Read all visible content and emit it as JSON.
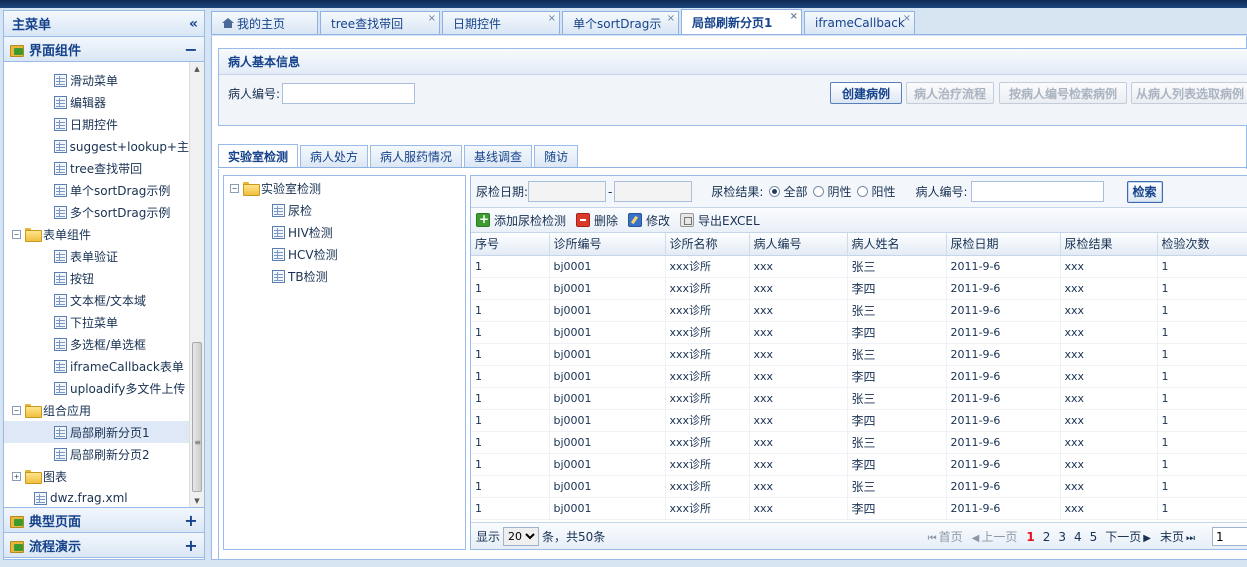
{
  "sidebar": {
    "title": "主菜单",
    "collapse_glyph": "«",
    "sections": [
      {
        "label": "界面组件",
        "toggle": "−"
      },
      {
        "label": "典型页面",
        "toggle": "+"
      },
      {
        "label": "流程演示",
        "toggle": "+"
      }
    ],
    "tree": [
      {
        "label": "滑动菜单",
        "type": "page",
        "level": 2
      },
      {
        "label": "编辑器",
        "type": "page",
        "level": 2
      },
      {
        "label": "日期控件",
        "type": "page",
        "level": 2
      },
      {
        "label": "suggest+lookup+主",
        "type": "page",
        "level": 2
      },
      {
        "label": "tree查找带回",
        "type": "page",
        "level": 2
      },
      {
        "label": "单个sortDrag示例",
        "type": "page",
        "level": 2
      },
      {
        "label": "多个sortDrag示例",
        "type": "page",
        "level": 2
      },
      {
        "label": "表单组件",
        "type": "folder",
        "level": 1,
        "exp": "−"
      },
      {
        "label": "表单验证",
        "type": "page",
        "level": 2
      },
      {
        "label": "按钮",
        "type": "page",
        "level": 2
      },
      {
        "label": "文本框/文本域",
        "type": "page",
        "level": 2
      },
      {
        "label": "下拉菜单",
        "type": "page",
        "level": 2
      },
      {
        "label": "多选框/单选框",
        "type": "page",
        "level": 2
      },
      {
        "label": "iframeCallback表单",
        "type": "page",
        "level": 2
      },
      {
        "label": "uploadify多文件上传",
        "type": "page",
        "level": 2
      },
      {
        "label": "组合应用",
        "type": "folder",
        "level": 1,
        "exp": "−"
      },
      {
        "label": "局部刷新分页1",
        "type": "page",
        "level": 2,
        "selected": true
      },
      {
        "label": "局部刷新分页2",
        "type": "page",
        "level": 2
      },
      {
        "label": "图表",
        "type": "folder",
        "level": 1,
        "exp": "+"
      },
      {
        "label": "dwz.frag.xml",
        "type": "page",
        "level": 1
      }
    ]
  },
  "tabs": [
    {
      "label": "我的主页",
      "home": true
    },
    {
      "label": "tree查找带回",
      "close": "×"
    },
    {
      "label": "日期控件",
      "close": "×"
    },
    {
      "label": "单个sortDrag示",
      "close": "×"
    },
    {
      "label": "局部刷新分页1",
      "close": "×",
      "active": true
    },
    {
      "label": "iframeCallback",
      "close": "×"
    }
  ],
  "patient": {
    "panel_title": "病人基本信息",
    "id_label": "病人编号:",
    "id_value": "",
    "buttons": {
      "create": "创建病例",
      "flow": "病人治疗流程",
      "search_by_id": "按病人编号检索病例",
      "pick_from_list": "从病人列表选取病例"
    }
  },
  "subtabs": [
    {
      "label": "实验室检测",
      "active": true
    },
    {
      "label": "病人处方"
    },
    {
      "label": "病人服药情况"
    },
    {
      "label": "基线调查"
    },
    {
      "label": "随访"
    }
  ],
  "lab_tree": {
    "root": "实验室检测",
    "root_exp": "−",
    "items": [
      "尿检",
      "HIV检测",
      "HCV检测",
      "TB检测"
    ]
  },
  "filter": {
    "date_label": "尿检日期:",
    "date_sep": "-",
    "result_label": "尿检结果:",
    "options": [
      "全部",
      "阴性",
      "阳性"
    ],
    "selected_option": 0,
    "pid_label": "病人编号:",
    "search_button": "检索"
  },
  "toolbar": {
    "add": "添加尿检检测",
    "delete": "删除",
    "edit": "修改",
    "export": "导出EXCEL"
  },
  "table": {
    "columns": [
      "序号",
      "诊所编号",
      "诊所名称",
      "病人编号",
      "病人姓名",
      "尿检日期",
      "尿检结果",
      "检验次数"
    ],
    "rows": [
      [
        "1",
        "bj0001",
        "xxx诊所",
        "xxx",
        "张三",
        "2011-9-6",
        "xxx",
        "1"
      ],
      [
        "1",
        "bj0001",
        "xxx诊所",
        "xxx",
        "李四",
        "2011-9-6",
        "xxx",
        "1"
      ],
      [
        "1",
        "bj0001",
        "xxx诊所",
        "xxx",
        "张三",
        "2011-9-6",
        "xxx",
        "1"
      ],
      [
        "1",
        "bj0001",
        "xxx诊所",
        "xxx",
        "李四",
        "2011-9-6",
        "xxx",
        "1"
      ],
      [
        "1",
        "bj0001",
        "xxx诊所",
        "xxx",
        "张三",
        "2011-9-6",
        "xxx",
        "1"
      ],
      [
        "1",
        "bj0001",
        "xxx诊所",
        "xxx",
        "李四",
        "2011-9-6",
        "xxx",
        "1"
      ],
      [
        "1",
        "bj0001",
        "xxx诊所",
        "xxx",
        "张三",
        "2011-9-6",
        "xxx",
        "1"
      ],
      [
        "1",
        "bj0001",
        "xxx诊所",
        "xxx",
        "李四",
        "2011-9-6",
        "xxx",
        "1"
      ],
      [
        "1",
        "bj0001",
        "xxx诊所",
        "xxx",
        "张三",
        "2011-9-6",
        "xxx",
        "1"
      ],
      [
        "1",
        "bj0001",
        "xxx诊所",
        "xxx",
        "李四",
        "2011-9-6",
        "xxx",
        "1"
      ],
      [
        "1",
        "bj0001",
        "xxx诊所",
        "xxx",
        "张三",
        "2011-9-6",
        "xxx",
        "1"
      ],
      [
        "1",
        "bj0001",
        "xxx诊所",
        "xxx",
        "李四",
        "2011-9-6",
        "xxx",
        "1"
      ]
    ]
  },
  "pager": {
    "show_label": "显示",
    "page_size": "20",
    "total_label": "条，共50条",
    "first": "首页",
    "prev": "上一页",
    "pages": [
      "1",
      "2",
      "3",
      "4",
      "5"
    ],
    "current_page": "1",
    "next": "下一页",
    "last": "末页",
    "jump_value": "1"
  },
  "colors": {
    "accent": "#15428b",
    "border": "#99bbe8",
    "current_page": "#e2131f"
  }
}
